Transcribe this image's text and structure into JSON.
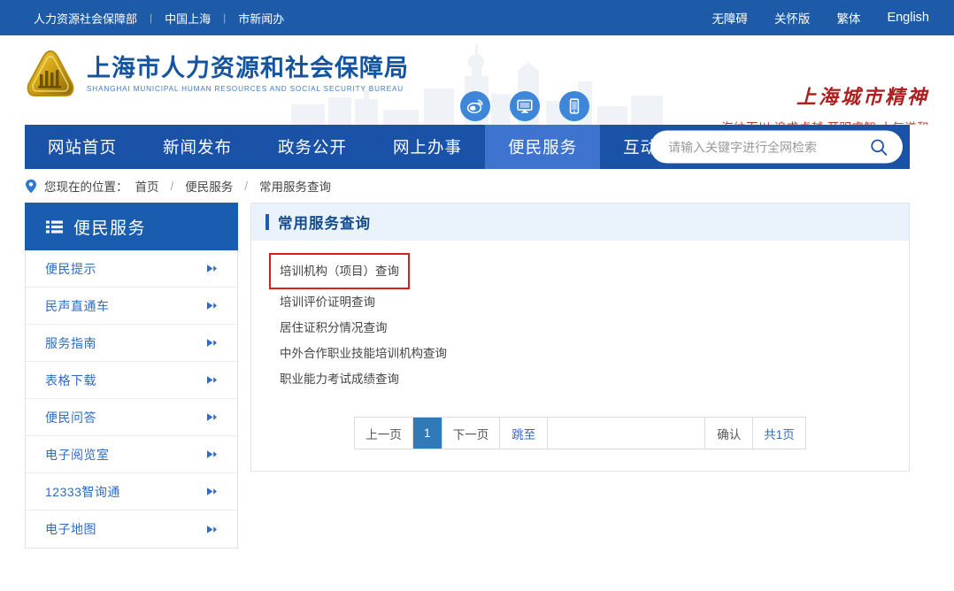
{
  "topbar": {
    "links": [
      "人力资源社会保障部",
      "中国上海",
      "市新闻办"
    ],
    "separator": "|",
    "right_links": [
      "无障碍",
      "关怀版",
      "繁体",
      "English"
    ]
  },
  "header": {
    "logo_cn": "上海市人力资源和社会保障局",
    "logo_en": "SHANGHAI MUNICIPAL HUMAN RESOURCES AND SOCIAL SECURITY BUREAU",
    "social": [
      {
        "name": "weibo-icon"
      },
      {
        "name": "desktop-icon"
      },
      {
        "name": "mobile-icon"
      }
    ],
    "spirit_title": "上海城市精神",
    "spirit_sub": "海纳百川 追求卓越 开明睿智 大气谦和"
  },
  "nav": {
    "items": [
      {
        "label": "网站首页",
        "active": false
      },
      {
        "label": "新闻发布",
        "active": false
      },
      {
        "label": "政务公开",
        "active": false
      },
      {
        "label": "网上办事",
        "active": false
      },
      {
        "label": "便民服务",
        "active": true
      },
      {
        "label": "互动交流",
        "active": false
      }
    ]
  },
  "search": {
    "placeholder": "请输入关键字进行全网检索",
    "value": ""
  },
  "breadcrumb": {
    "prefix": "您现在的位置：",
    "items": [
      "首页",
      "便民服务",
      "常用服务查询"
    ],
    "separator": "/"
  },
  "sidebar": {
    "title": "便民服务",
    "items": [
      {
        "label": "便民提示"
      },
      {
        "label": "民声直通车"
      },
      {
        "label": "服务指南"
      },
      {
        "label": "表格下载"
      },
      {
        "label": "便民问答"
      },
      {
        "label": "电子阅览室"
      },
      {
        "label": "12333智询通"
      },
      {
        "label": "电子地图"
      }
    ]
  },
  "panel": {
    "title": "常用服务查询",
    "services": [
      {
        "label": "培训机构（项目）查询",
        "highlighted": true
      },
      {
        "label": "培训评价证明查询",
        "highlighted": false
      },
      {
        "label": "居住证积分情况查询",
        "highlighted": false
      },
      {
        "label": "中外合作职业技能培训机构查询",
        "highlighted": false
      },
      {
        "label": "职业能力考试成绩查询",
        "highlighted": false
      }
    ]
  },
  "pagination": {
    "prev": "上一页",
    "current_page": "1",
    "next": "下一页",
    "jump_label": "跳至",
    "jump_value": "",
    "confirm": "确认",
    "total": "共1页"
  },
  "colors": {
    "topbar_blue": "#1d5aa8",
    "nav_blue": "#1a52a8",
    "nav_active_blue": "#3e74cf",
    "sidebar_head_blue": "#1a5cb0",
    "link_blue": "#2f6cc0",
    "panel_head_bg": "#eaf2fb",
    "highlight_red": "#e01b1b",
    "spirit_red": "#b01f1f",
    "page_active": "#3279b7"
  }
}
